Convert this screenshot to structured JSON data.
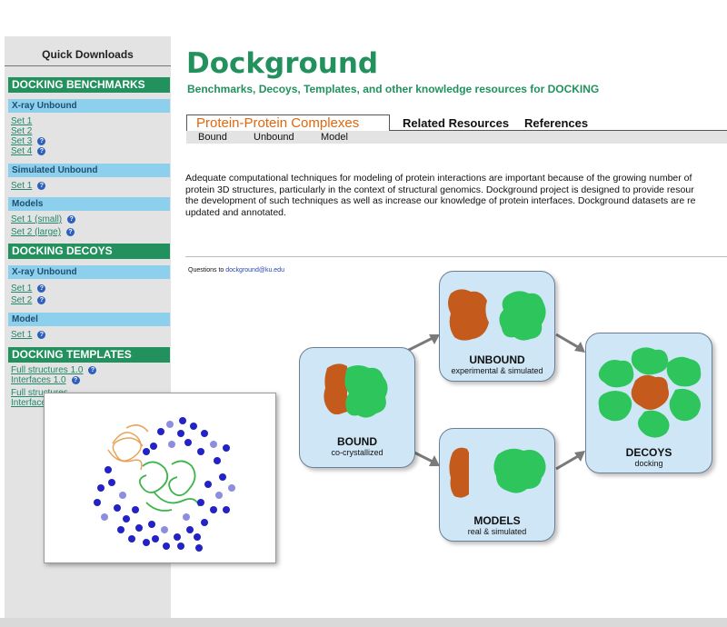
{
  "sidebar": {
    "title": "Quick Downloads",
    "sections": [
      {
        "heading": "DOCKING BENCHMARKS"
      },
      {
        "heading": "DOCKING DECOYS"
      },
      {
        "heading": "DOCKING TEMPLATES"
      }
    ],
    "benchmarks": {
      "xray": {
        "label": "X-ray Unbound",
        "links": [
          "Set 1",
          "Set 2",
          "Set 3",
          "Set 4"
        ]
      },
      "simulated": {
        "label": "Simulated Unbound",
        "links": [
          "Set 1"
        ]
      },
      "models": {
        "label": "Models",
        "links": [
          "Set 1 (small)",
          "Set 2 (large)"
        ]
      }
    },
    "decoys": {
      "xray": {
        "label": "X-ray Unbound",
        "links": [
          "Set 1",
          "Set 2"
        ]
      },
      "model": {
        "label": "Model",
        "links": [
          "Set 1"
        ]
      }
    },
    "templates": {
      "links": [
        "Full structures 1.0",
        "Interfaces 1.0",
        "Full structures",
        "Interfaces"
      ]
    },
    "help_glyph": "?"
  },
  "header": {
    "title": "Dockground",
    "subtitle": "Benchmarks, Decoys, Templates, and other knowledge resources for DOCKING"
  },
  "tabs": {
    "active": "Protein-Protein Complexes",
    "others": [
      "Related Resources",
      "References"
    ],
    "subtabs": [
      "Bound",
      "Unbound",
      "Model"
    ]
  },
  "intro": {
    "lines": [
      "Adequate computational techniques for modeling of protein interactions are important because of the growing number of",
      "protein 3D structures, particularly in the context of structural genomics. Dockground project is designed to provide resour",
      "the development of such techniques as well as increase our knowledge of protein interfaces. Dockground datasets are re",
      "updated and annotated."
    ]
  },
  "contact": {
    "prefix": "Questions to",
    "email": "dockground@ku.edu"
  },
  "diagram": {
    "bound": {
      "title": "BOUND",
      "subtitle": "co-crystallized"
    },
    "unbound": {
      "title": "UNBOUND",
      "subtitle": "experimental & simulated"
    },
    "models": {
      "title": "MODELS",
      "subtitle": "real & simulated"
    },
    "decoys": {
      "title": "DECOYS",
      "subtitle": "docking"
    }
  },
  "colors": {
    "brand_green": "#23915d",
    "section_green": "#23915d",
    "subheading_blue": "#8dd0ee",
    "tab_orange": "#e0670e",
    "protein_orange": "#c45a1c",
    "protein_green": "#2ec65c",
    "box_fill": "#cfe6f6"
  }
}
